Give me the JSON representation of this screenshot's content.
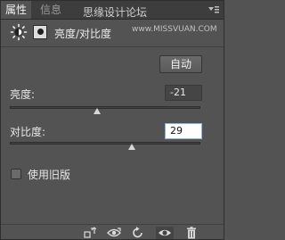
{
  "tabs": [
    {
      "label": "属性",
      "active": true
    },
    {
      "label": "信息",
      "active": false
    }
  ],
  "watermark": {
    "text": "思缘设计论坛",
    "url": "www.MISSVUAN.COM"
  },
  "adjustment": {
    "title": "亮度/对比度",
    "icon": "sun-icon",
    "mask_icon": "mask-icon"
  },
  "auto_button": "自动",
  "brightness": {
    "label": "亮度:",
    "value": "-21",
    "slider_fraction": 0.46
  },
  "contrast": {
    "label": "对比度:",
    "value": "29",
    "slider_fraction": 0.64
  },
  "legacy": {
    "label": "使用旧版",
    "checked": false
  },
  "toolbar": {
    "icons": [
      "clip-to-layer-icon",
      "view-previous-state-icon",
      "reset-icon",
      "visibility-eye-icon",
      "trash-icon"
    ]
  },
  "colors": {
    "panel_bg": "#535353",
    "tabbar_bg": "#3d3d3d",
    "field_bg": "#454545",
    "focus_field_bg": "#ffffff"
  }
}
